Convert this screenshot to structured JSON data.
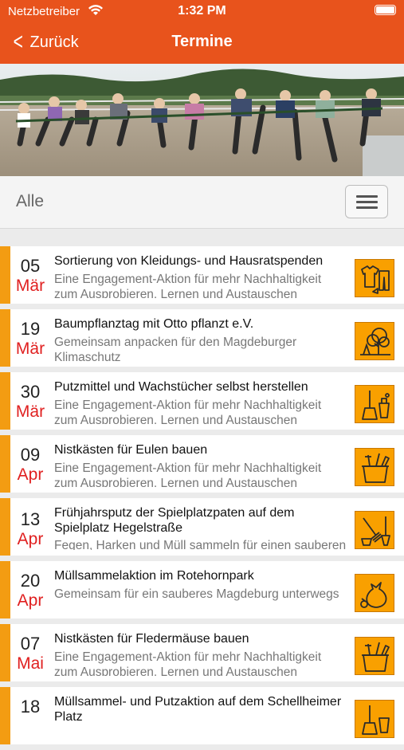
{
  "status": {
    "carrier": "Netzbetreiber",
    "time": "1:32 PM"
  },
  "nav": {
    "back_label": "Zurück",
    "title": "Termine"
  },
  "filter": {
    "label": "Alle"
  },
  "colors": {
    "accent": "#e8531c",
    "bar": "#f39c12",
    "icon_bg": "#f9a000",
    "month": "#e02020"
  },
  "events": [
    {
      "day": "05",
      "month": "Mär",
      "title": "Sortierung von Kleidungs- und Hausratspenden",
      "subtitle": "Eine Engagement-Aktion für mehr Nachhaltigkeit zum Ausprobieren, Lernen und Austauschen",
      "icon": "clothes-icon"
    },
    {
      "day": "19",
      "month": "Mär",
      "title": "Baumpflanztag mit Otto pflanzt e.V.",
      "subtitle": "Gemeinsam anpacken für den Magdeburger Klimaschutz",
      "icon": "tree-icon"
    },
    {
      "day": "30",
      "month": "Mär",
      "title": "Putzmittel und Wachstücher selbst herstellen",
      "subtitle": "Eine Engagement-Aktion für mehr Nachhaltigkeit zum Ausprobieren, Lernen und Austauschen",
      "icon": "cleaning-icon"
    },
    {
      "day": "09",
      "month": "Apr",
      "title": "Nistkästen für Eulen bauen",
      "subtitle": "Eine Engagement-Aktion für mehr Nachhaltigkeit zum Ausprobieren, Lernen und Austauschen",
      "icon": "tools-icon"
    },
    {
      "day": "13",
      "month": "Apr",
      "title": "Frühjahrsputz der Spielplatzpaten auf dem Spielplatz Hegelstraße",
      "subtitle": "Fegen, Harken und Müll sammeln für einen sauberen Spielplatz",
      "icon": "rake-icon"
    },
    {
      "day": "20",
      "month": "Apr",
      "title": "Müllsammelaktion im Rotehornpark",
      "subtitle": "Gemeinsam für ein sauberes Magdeburg unterwegs",
      "icon": "trash-bag-icon"
    },
    {
      "day": "07",
      "month": "Mai",
      "title": "Nistkästen für Fledermäuse bauen",
      "subtitle": "Eine Engagement-Aktion für mehr Nachhaltigkeit zum Ausprobieren, Lernen und Austauschen",
      "icon": "tools-icon"
    },
    {
      "day": "18",
      "month": "",
      "title": "Müllsammel- und Putzaktion auf dem Schellheimer Platz",
      "subtitle": "",
      "icon": "cleaning-icon"
    }
  ]
}
